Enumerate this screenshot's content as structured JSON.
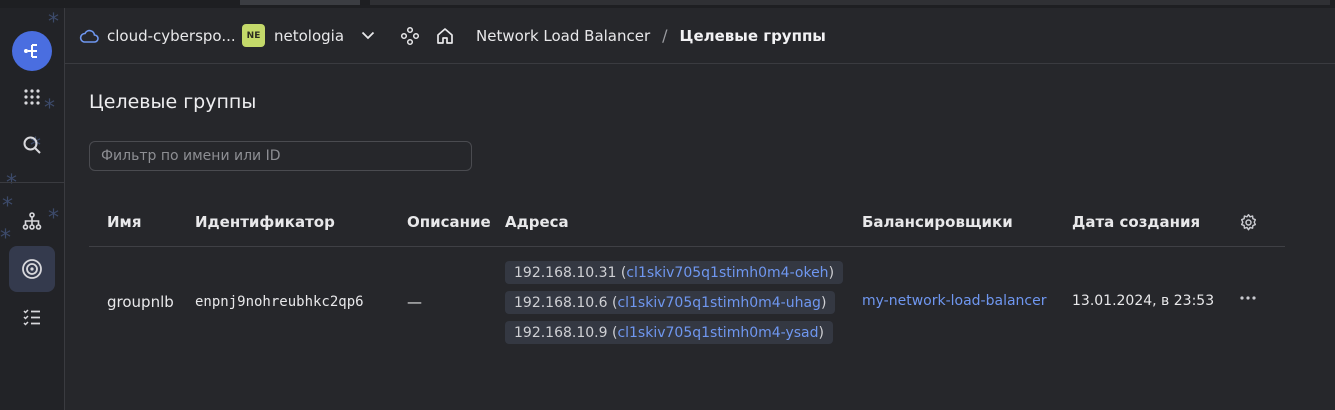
{
  "header": {
    "cloud_name": "cloud-cyberspo...",
    "folder_badge": "NE",
    "folder_name": "netologia",
    "breadcrumb_service": "Network Load Balancer",
    "breadcrumb_separator": "/",
    "breadcrumb_current": "Целевые группы"
  },
  "page": {
    "title": "Целевые группы",
    "filter_placeholder": "Фильтр по имени или ID",
    "filter_value": ""
  },
  "table": {
    "columns": [
      "Имя",
      "Идентификатор",
      "Описание",
      "Адреса",
      "Балансировщики",
      "Дата создания"
    ],
    "rows": [
      {
        "name": "groupnlb",
        "id": "enpnj9nohreubhkc2qp6",
        "description": "—",
        "addresses": [
          {
            "ip": "192.168.10.31",
            "open": " (",
            "instance": "cl1skiv705q1stimh0m4-okeh",
            "close": ")"
          },
          {
            "ip": "192.168.10.6",
            "open": " (",
            "instance": "cl1skiv705q1stimh0m4-uhag",
            "close": ")"
          },
          {
            "ip": "192.168.10.9",
            "open": " (",
            "instance": "cl1skiv705q1stimh0m4-ysad",
            "close": ")"
          }
        ],
        "balancer": "my-network-load-balancer",
        "created": "13.01.2024, в 23:53"
      }
    ]
  },
  "icons": {
    "rail": [
      "services-icon",
      "apps-grid-icon",
      "search-icon",
      "hierarchy-icon",
      "target-icon",
      "checklist-icon"
    ],
    "settings": "gear-icon",
    "row_actions": "more-horizontal-icon"
  },
  "colors": {
    "accent": "#4a6ee0",
    "link": "#6f97f0",
    "background": "#26272b",
    "badge": "#c4d96a"
  }
}
